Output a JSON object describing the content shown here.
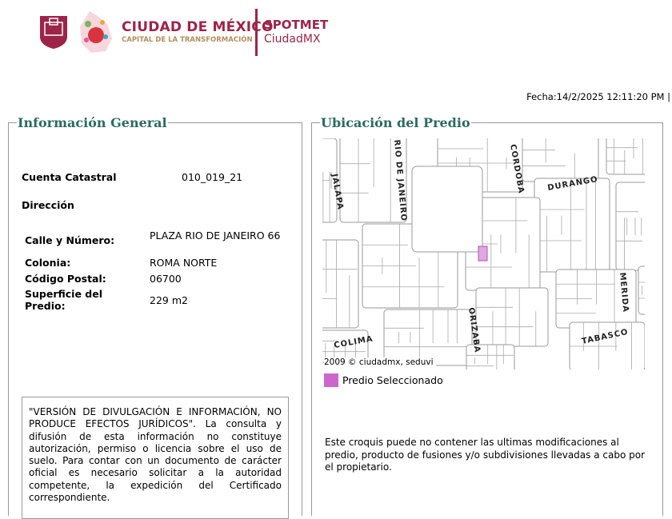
{
  "header": {
    "logo_title": "CIUDAD DE MÉXICO",
    "logo_subtitle": "CAPITAL DE LA TRANSFORMACIÓN",
    "app_name": "SPOTMET",
    "app_sub": "CiudadMX",
    "fecha": "Fecha:14/2/2025 12:11:20 PM |"
  },
  "info": {
    "legend": "Información General",
    "cuenta_label": "Cuenta Catastral",
    "cuenta_value": "010_019_21",
    "direccion_label": "Dirección",
    "calle_label": "Calle y Número:",
    "calle_value": "PLAZA RIO DE JANEIRO 66",
    "colonia_label": "Colonia:",
    "colonia_value": "ROMA NORTE",
    "cp_label": "Código Postal:",
    "cp_value": "06700",
    "superficie_label": "Superficie del Predio:",
    "superficie_value": "229 m2",
    "disclaimer": "\"VERSIÓN DE DIVULGACIÓN E INFORMACIÓN, NO PRODUCE EFECTOS JURÍDICOS\". La consulta y difusión de esta información no constituye autorización, permiso o licencia sobre el uso de suelo. Para contar con un documento de carácter oficial es necesario solicitar a la autoridad competente, la expedición del Certificado correspondiente."
  },
  "ubicacion": {
    "legend": "Ubicación del Predio",
    "streets": [
      "RIO DE JANEIRO",
      "JALAPA",
      "CORDOBA",
      "DURANGO",
      "MERIDA",
      "ORIZABA",
      "COLIMA",
      "TABASCO"
    ],
    "copyright": "2009 © ciudadmx, seduvi",
    "legend_item": "Predio Seleccionado",
    "selected_color": "#cc66cc",
    "note": "Este croquis puede no contener las ultimas modificaciones al predio, producto de fusiones y/o subdivisiones llevadas a cabo por el propietario."
  }
}
